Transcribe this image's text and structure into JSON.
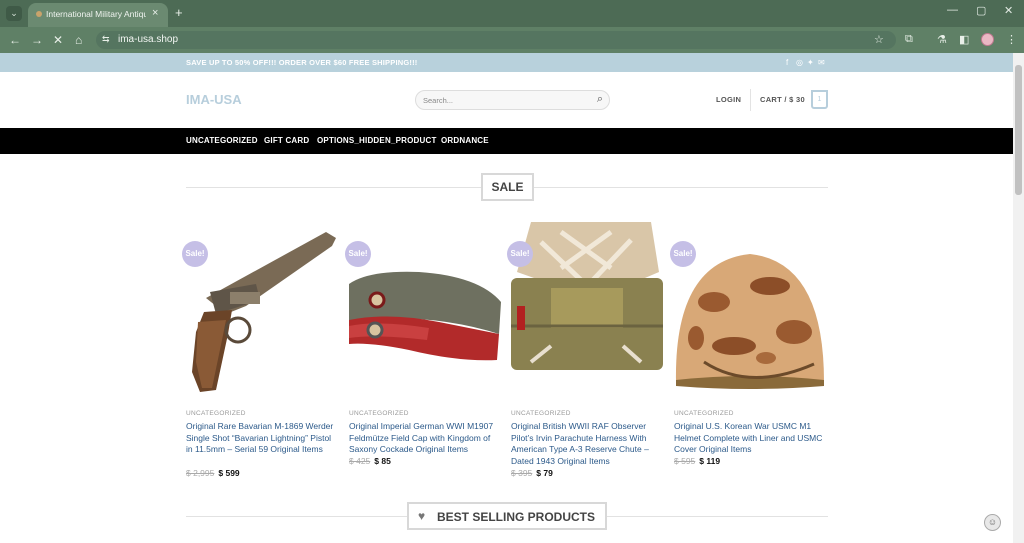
{
  "browser": {
    "tab_title": "International Military Antiques",
    "url": "ima-usa.shop",
    "new_tab": "+",
    "tab_close": "×"
  },
  "promo": {
    "message": "SAVE UP TO 50% OFF!!! ORDER OVER $60 FREE SHIPPING!!!"
  },
  "header": {
    "logo": "IMA-USA",
    "search_placeholder": "Search...",
    "login": "LOGIN",
    "cart": "CART / $ 30",
    "cart_count": "1"
  },
  "nav": {
    "items": [
      "UNCATEGORIZED",
      "GIFT CARD",
      "OPTIONS_HIDDEN_PRODUCT",
      "ORDNANCE"
    ]
  },
  "sale": {
    "heading": "SALE",
    "badge": "Sale!",
    "products": [
      {
        "category": "UNCATEGORIZED",
        "name": "Original Rare Bavarian M-1869 Werder Single Shot “Bavarian Lightning” Pistol in 11.5mm – Serial 59 Original Items",
        "old_price": "$ 2,995",
        "new_price": "$ 599"
      },
      {
        "category": "UNCATEGORIZED",
        "name": "Original Imperial German WWI M1907 Feldmütze Field Cap with Kingdom of Saxony Cockade Original Items",
        "old_price": "$ 425",
        "new_price": "$ 85"
      },
      {
        "category": "UNCATEGORIZED",
        "name": "Original British WWII RAF Observer Pilot’s Irvin Parachute Harness With American Type A-3 Reserve Chute – Dated 1943 Original Items",
        "old_price": "$ 395",
        "new_price": "$ 79"
      },
      {
        "category": "UNCATEGORIZED",
        "name": "Original U.S. Korean War USMC M1 Helmet Complete with Liner and USMC Cover Original Items",
        "old_price": "$ 595",
        "new_price": "$ 119"
      }
    ]
  },
  "best_selling": {
    "heading": "BEST SELLING PRODUCTS"
  },
  "colors": {
    "chrome": "#4d6b55",
    "promo_bar": "#b8d1dc",
    "logo": "#b7cedc",
    "link": "#2c5a8a",
    "sale_badge": "#c5bfe6"
  }
}
